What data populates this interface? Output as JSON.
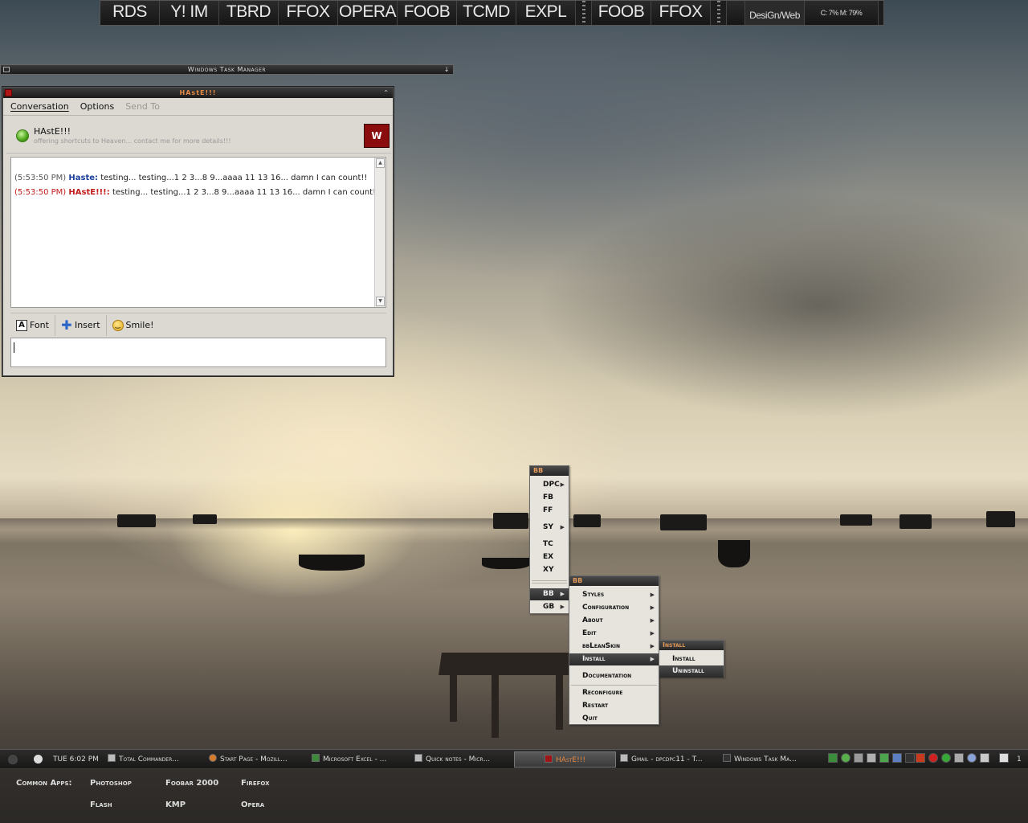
{
  "toolbar": {
    "buttons": [
      "RDS",
      "Y! IM",
      "TBRD",
      "FFOX",
      "OPERA",
      "FOOB",
      "TCMD",
      "EXPL",
      "FOOB",
      "FFOX"
    ],
    "workspace": "DesiGn/Web",
    "stats": "C: 7% M: 79%"
  },
  "taskmanager": {
    "title": "Windows Task Manager",
    "control": "↓"
  },
  "haste": {
    "title": "HAstE!!!",
    "menu": {
      "conversation": "Conversation",
      "options": "Options",
      "sendto": "Send To"
    },
    "contact": {
      "name": "HAstE!!!",
      "status": "offering shortcuts to Heaven... contact me for more details!!!",
      "logo": "W"
    },
    "messages": [
      {
        "time": "(5:53:50 PM)",
        "user": "Haste:",
        "text": "testing... testing...1 2 3...8 9...aaaa 11 13 16... damn I can count!!"
      },
      {
        "time": "(5:53:50 PM)",
        "user": "HAstE!!!:",
        "text": "testing... testing...1 2 3...8 9...aaaa 11 13 16... damn I can count!!"
      }
    ],
    "format": {
      "font": "Font",
      "insert": "Insert",
      "smile": "Smile!"
    }
  },
  "menus": {
    "root": {
      "title": "BB",
      "items": [
        "DPC",
        "FB",
        "FF",
        "SY",
        "TC",
        "EX",
        "XY",
        "BB",
        "GB"
      ]
    },
    "bb": {
      "title": "BB",
      "items": [
        "Styles",
        "Configuration",
        "About",
        "Edit",
        "bbLeanSkin",
        "Install",
        "Documentation",
        "Reconfigure",
        "Restart",
        "Quit"
      ]
    },
    "install": {
      "title": "Install",
      "items": [
        "Install",
        "Uninstall"
      ]
    }
  },
  "taskbar": {
    "clock": "TUE 6:02 PM",
    "tasks": [
      "Total Commander...",
      "Start Page - Mozill...",
      "Microsoft Excel - ...",
      "Quick notes - Micr...",
      "HAstE!!!",
      "Gmail - dpcdpc11 - T...",
      "Windows Task Ma..."
    ],
    "workspace_num": "1"
  },
  "apps": {
    "label": "Common Apps:",
    "items": [
      "Photoshop",
      "Foobar 2000",
      "Firefox",
      "Flash",
      "KMP",
      "Opera"
    ]
  },
  "colors": {
    "accent": "#e58a44",
    "user1": "#1b3f9c",
    "user2": "#c21b1b"
  }
}
